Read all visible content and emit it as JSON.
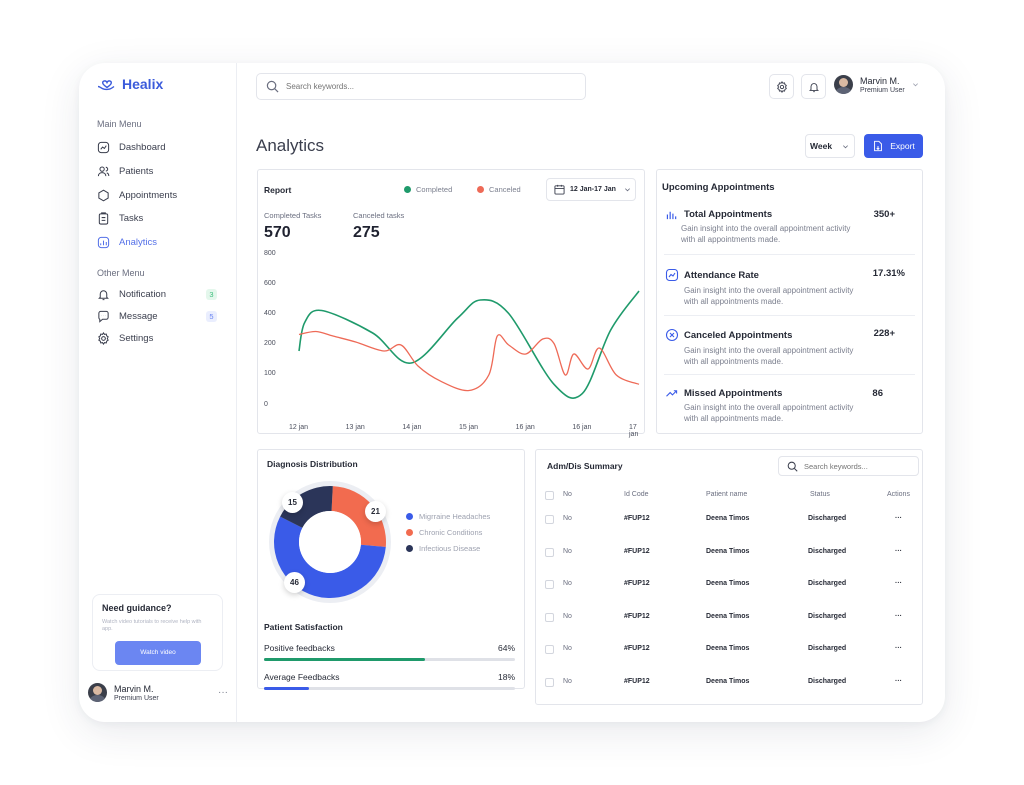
{
  "app": {
    "name": "Healix"
  },
  "sidebar": {
    "main_menu_title": "Main Menu",
    "main_items": [
      {
        "label": "Dashboard",
        "icon": "dashboard-icon"
      },
      {
        "label": "Patients",
        "icon": "users-icon"
      },
      {
        "label": "Appointments",
        "icon": "hexagon-icon"
      },
      {
        "label": "Tasks",
        "icon": "clipboard-icon"
      },
      {
        "label": "Analytics",
        "icon": "chart-icon",
        "active": true
      }
    ],
    "other_menu_title": "Other Menu",
    "other_items": [
      {
        "label": "Notification",
        "icon": "bell-icon",
        "badge": "3",
        "badge_color": "#3fbf7f",
        "badge_bg": "#e4f7ec"
      },
      {
        "label": "Message",
        "icon": "chat-icon",
        "badge": "5",
        "badge_color": "#6b86f2",
        "badge_bg": "#eaeefe"
      },
      {
        "label": "Settings",
        "icon": "gear-icon"
      }
    ],
    "guidance": {
      "title": "Need guidance?",
      "subtitle": "Watch video tutorials to receive help with app.",
      "button": "Watch video"
    },
    "user": {
      "name": "Marvin M.",
      "role": "Premium User"
    }
  },
  "header": {
    "search_placeholder": "Search keywords...",
    "user": {
      "name": "Marvin M.",
      "role": "Premium User"
    }
  },
  "page": {
    "title": "Analytics",
    "period": "Week",
    "export_label": "Export"
  },
  "report": {
    "title": "Report",
    "legend_completed": "Completed",
    "legend_canceled": "Canceled",
    "date_range": "12 Jan-17 Jan",
    "completed_label": "Completed Tasks",
    "completed_value": "570",
    "canceled_label": "Canceled tasks",
    "canceled_value": "275",
    "colors": {
      "completed": "#1f9a6b",
      "canceled": "#ee6a57"
    }
  },
  "chart_data": {
    "type": "line",
    "x": [
      "12 jan",
      "13 jan",
      "14 jan",
      "15 jan",
      "16 jan",
      "16 jan",
      "17 jan"
    ],
    "ylim": [
      0,
      800
    ],
    "yticks": [
      "800",
      "600",
      "400",
      "200",
      "100",
      "0"
    ],
    "series": [
      {
        "name": "Completed",
        "color": "#1f9a6b",
        "points": [
          [
            0,
            180
          ],
          [
            0.1,
            350
          ],
          [
            0.4,
            430
          ],
          [
            1.3,
            280
          ],
          [
            1.98,
            140
          ],
          [
            2.8,
            380
          ],
          [
            3.2,
            500
          ],
          [
            3.7,
            410
          ],
          [
            4.5,
            70
          ],
          [
            5,
            40
          ],
          [
            5.5,
            300
          ],
          [
            6,
            560
          ]
        ]
      },
      {
        "name": "Canceled",
        "color": "#ee6a57",
        "points": [
          [
            0,
            270
          ],
          [
            0.3,
            290
          ],
          [
            0.6,
            260
          ],
          [
            1,
            220
          ],
          [
            1.5,
            180
          ],
          [
            1.8,
            200
          ],
          [
            2.1,
            130
          ],
          [
            2.5,
            80
          ],
          [
            3,
            50
          ],
          [
            3.35,
            100
          ],
          [
            3.5,
            260
          ],
          [
            3.7,
            200
          ],
          [
            4,
            170
          ],
          [
            4.3,
            240
          ],
          [
            4.5,
            210
          ],
          [
            4.7,
            100
          ],
          [
            4.85,
            170
          ],
          [
            5.1,
            120
          ],
          [
            5.3,
            190
          ],
          [
            5.6,
            100
          ],
          [
            6,
            70
          ]
        ]
      }
    ]
  },
  "upcoming": {
    "title": "Upcoming Appointments",
    "items": [
      {
        "icon": "bar-chart-icon",
        "title": "Total Appointments",
        "value": "350+",
        "desc": "Gain insight into the overall appointment activity with all appointments made."
      },
      {
        "icon": "attendance-icon",
        "title": "Attendance Rate",
        "value": "17.31%",
        "desc": "Gain insight into the overall appointment activity with all appointments made."
      },
      {
        "icon": "cancel-icon",
        "title": "Canceled Appointments",
        "value": "228+",
        "desc": "Gain insight into the overall appointment activity with all appointments made."
      },
      {
        "icon": "trend-icon",
        "title": "Missed Appointments",
        "value": "86",
        "desc": "Gain insight into the overall appointment activity with all appointments made."
      }
    ]
  },
  "diagnosis": {
    "title": "Diagnosis Distribution",
    "segments": [
      {
        "label": "Migrraine Headaches",
        "value": 46,
        "color": "#3a5be8"
      },
      {
        "label": "Chronic Conditions",
        "value": 21,
        "color": "#f26b4f"
      },
      {
        "label": "Infectious Disease",
        "value": 15,
        "color": "#2b3559"
      }
    ],
    "labels": [
      "15",
      "21",
      "46"
    ]
  },
  "satisfaction": {
    "title": "Patient Satisfaction",
    "rows": [
      {
        "label": "Positive feedbacks",
        "value": "64%",
        "fraction": 0.64,
        "color": "#1f9a6b"
      },
      {
        "label": "Average Feedbacks",
        "value": "18%",
        "fraction": 0.18,
        "color": "#3a5be8"
      }
    ]
  },
  "summary": {
    "title": "Adm/Dis Summary",
    "search_placeholder": "Search keywords...",
    "columns": [
      "No",
      "Id Code",
      "Patient name",
      "Status",
      "Actions"
    ],
    "rows": [
      {
        "no": "No",
        "id": "#FUP12",
        "name": "Deena Timos",
        "status": "Discharged",
        "action": "···"
      },
      {
        "no": "No",
        "id": "#FUP12",
        "name": "Deena Timos",
        "status": "Discharged",
        "action": "···"
      },
      {
        "no": "No",
        "id": "#FUP12",
        "name": "Deena Timos",
        "status": "Discharged",
        "action": "···"
      },
      {
        "no": "No",
        "id": "#FUP12",
        "name": "Deena Timos",
        "status": "Discharged",
        "action": "···"
      },
      {
        "no": "No",
        "id": "#FUP12",
        "name": "Deena Timos",
        "status": "Discharged",
        "action": "···"
      },
      {
        "no": "No",
        "id": "#FUP12",
        "name": "Deena Timos",
        "status": "Discharged",
        "action": "···"
      }
    ]
  }
}
